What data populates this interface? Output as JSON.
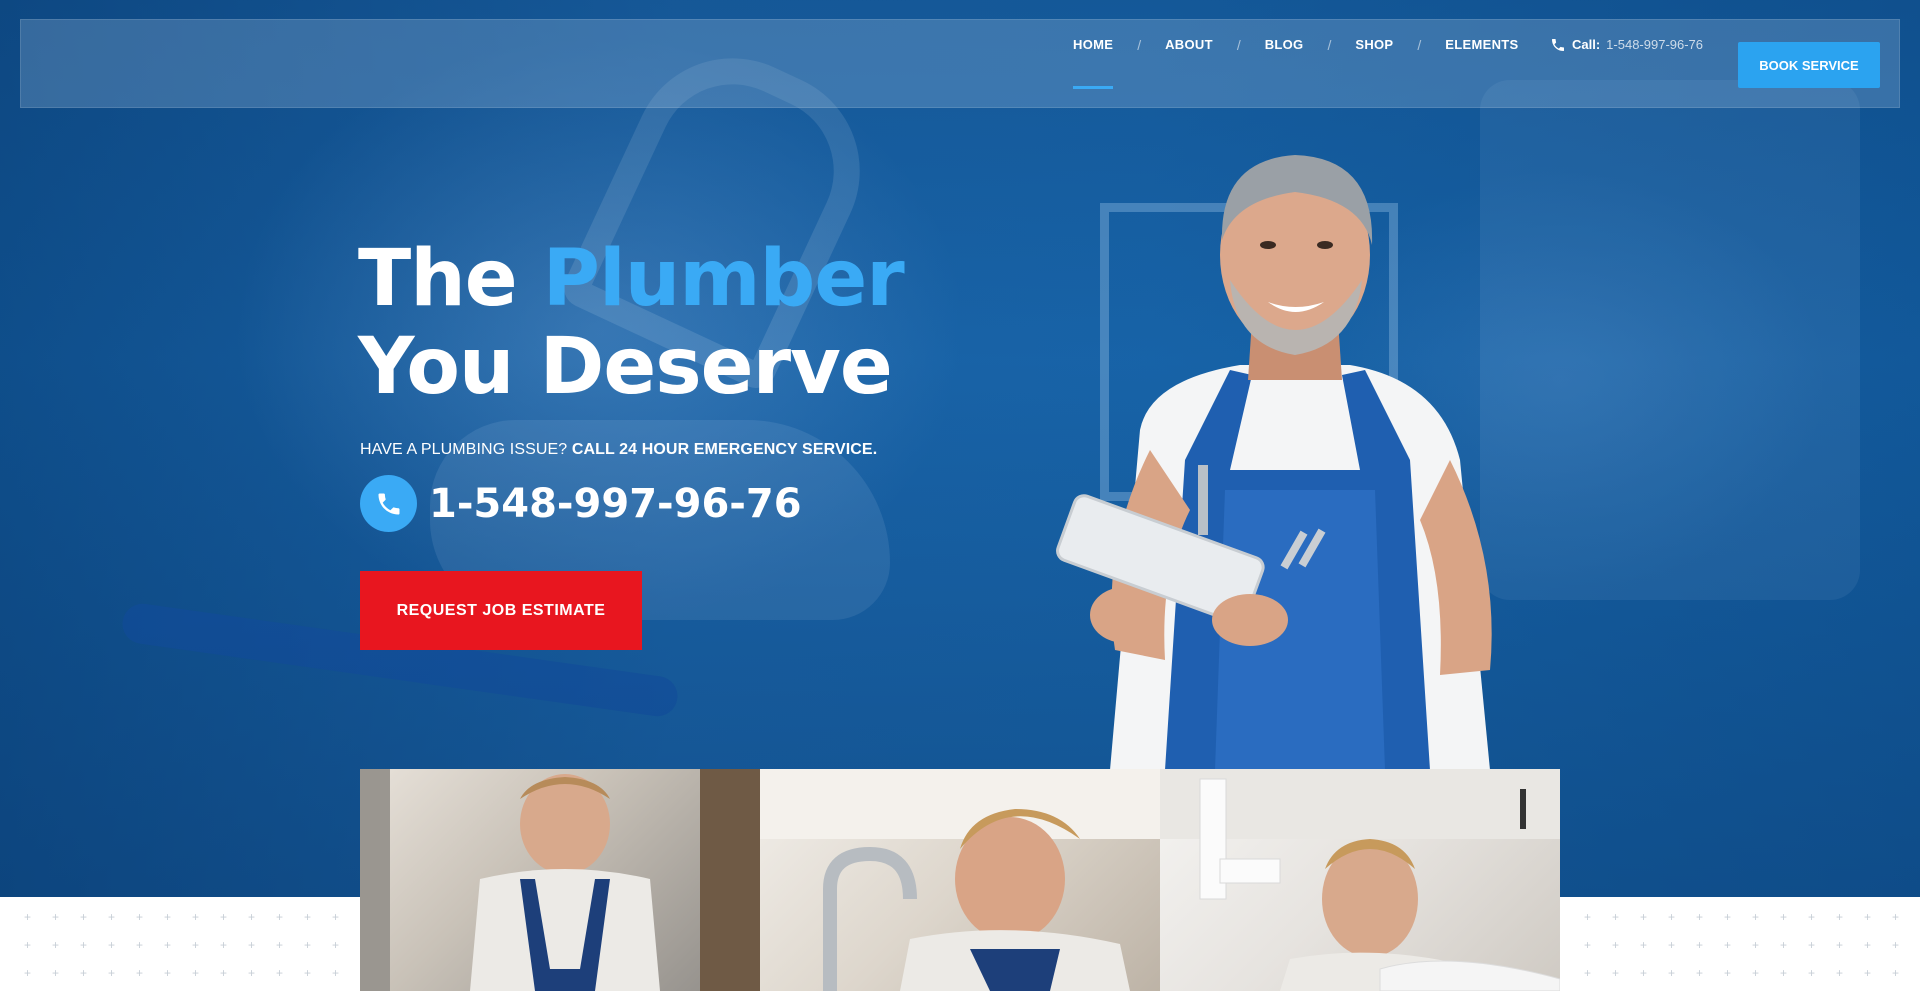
{
  "nav": {
    "items": [
      {
        "label": "HOME",
        "active": true
      },
      {
        "label": "ABOUT",
        "active": false
      },
      {
        "label": "BLOG",
        "active": false
      },
      {
        "label": "SHOP",
        "active": false
      },
      {
        "label": "ELEMENTS",
        "active": false
      }
    ],
    "separator": "/",
    "phone_label": "Call:",
    "phone_number": "1-548-997-96-76",
    "phone_icon": "phone-icon",
    "book_button": "BOOK SERVICE"
  },
  "hero": {
    "title_line1_plain": "The ",
    "title_line1_accent": "Plumber",
    "title_line2": "You Deserve",
    "subtitle_plain": "HAVE A PLUMBING ISSUE? ",
    "subtitle_bold": "CALL 24 HOUR EMERGENCY SERVICE.",
    "phone_number": "1-548-997-96-76",
    "phone_icon": "phone-icon",
    "cta_button": "REQUEST JOB ESTIMATE"
  },
  "colors": {
    "hero_blue": "#1865aa",
    "accent_blue": "#3aaaf5",
    "book_button": "#2ba3f0",
    "cta_red": "#e8161f",
    "text_white": "#ffffff"
  },
  "cards": [
    {
      "image": "plumber-under-sink-photo"
    },
    {
      "image": "plumber-faucet-photo"
    },
    {
      "image": "plumber-pipes-photo"
    }
  ]
}
